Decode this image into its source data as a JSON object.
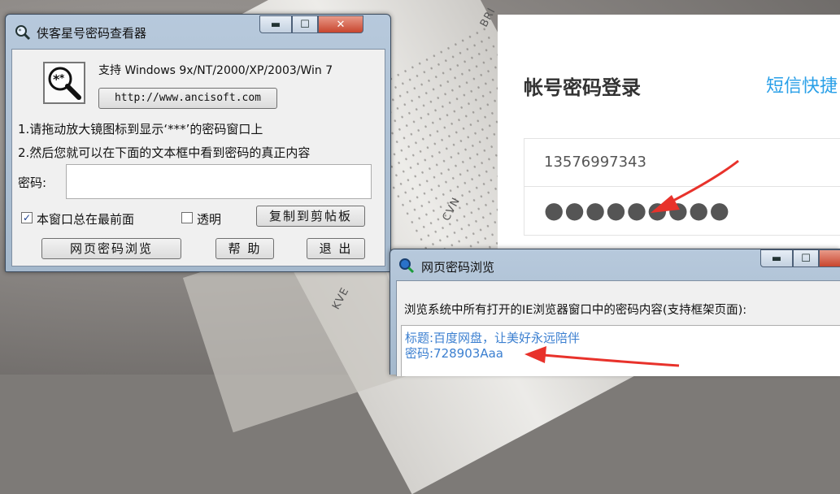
{
  "background": {
    "key_labels": [
      "BRI",
      "CVN",
      "KVE"
    ]
  },
  "web_login": {
    "title": "帐号密码登录",
    "sms_link": "短信快捷",
    "account_value": "13576997343",
    "password_masked": "●●●●●●●●●"
  },
  "main_window": {
    "title": "侠客星号密码查看器",
    "support_text": "支持 Windows 9x/NT/2000/XP/2003/Win 7",
    "url_button": "http://www.ancisoft.com",
    "instruction_1": "1.请拖动放大镜图标到显示‘***’的密码窗口上",
    "instruction_2": "2.然后您就可以在下面的文本框中看到密码的真正内容",
    "password_label": "密码:",
    "password_value": "",
    "always_on_top_label": "本窗口总在最前面",
    "always_on_top_checked": true,
    "transparent_label": "透明",
    "transparent_checked": false,
    "copy_button": "复制到剪帖板",
    "web_password_button": "网页密码浏览",
    "help_button": "帮 助",
    "exit_button": "退 出",
    "minimize_glyph": "▬",
    "maximize_glyph": "☐",
    "close_glyph": "✕"
  },
  "web_pwd_window": {
    "title": "网页密码浏览",
    "description": "浏览系统中所有打开的IE浏览器窗口中的密码内容(支持框架页面):",
    "result_title_line": "标题:百度网盘，让美好永远陪伴",
    "result_password_line": "密码:728903Aaa",
    "minimize_glyph": "▬",
    "maximize_glyph": "☐"
  },
  "colors": {
    "link_blue": "#2aa0e8",
    "result_blue": "#3b7fd0",
    "arrow_red": "#e8322b"
  }
}
